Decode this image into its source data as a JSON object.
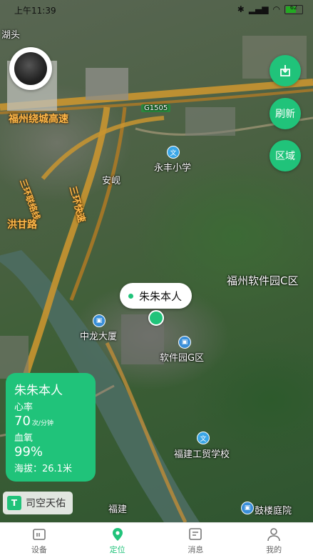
{
  "status_bar": {
    "time": "上午11:39",
    "battery": "62"
  },
  "map": {
    "labels": {
      "hutou": "湖头",
      "fuzhou_ring": "福州绕城高速",
      "g1505": "G1505",
      "ring_connect": "三环联络线",
      "sanhuan": "三环快速",
      "hongganlu": "洪甘路",
      "anxian": "安岘",
      "yongfeng_school": "永丰小学",
      "software_park_c": "福州软件园C区",
      "zhonglong": "中龙大厦",
      "software_park_g": "软件园G区",
      "fujian_school": "福建工贸学校",
      "fujian_bottom": "福建",
      "gulou": "鼓楼庭院"
    },
    "poi_icon_glyph": "文"
  },
  "side_buttons": {
    "refresh": "刷新",
    "region": "区域"
  },
  "marker": {
    "name": "朱朱本人"
  },
  "info_card": {
    "name": "朱朱本人",
    "heart_rate_label": "心率",
    "heart_rate_value": "70",
    "heart_rate_unit": "次/分钟",
    "blood_oxygen_label": "血氧",
    "blood_oxygen_value": "99%",
    "altitude": "海拔：26.1米"
  },
  "brand": {
    "logo_glyph": "T",
    "name": "司空天佑"
  },
  "nav": {
    "items": [
      {
        "label": "设备",
        "icon": "device-icon"
      },
      {
        "label": "定位",
        "icon": "location-icon"
      },
      {
        "label": "消息",
        "icon": "message-icon"
      },
      {
        "label": "我的",
        "icon": "profile-icon"
      }
    ],
    "active_index": 1
  },
  "colors": {
    "accent": "#20c37a",
    "poi": "#3aa6e6",
    "road": "#d9a13a"
  }
}
